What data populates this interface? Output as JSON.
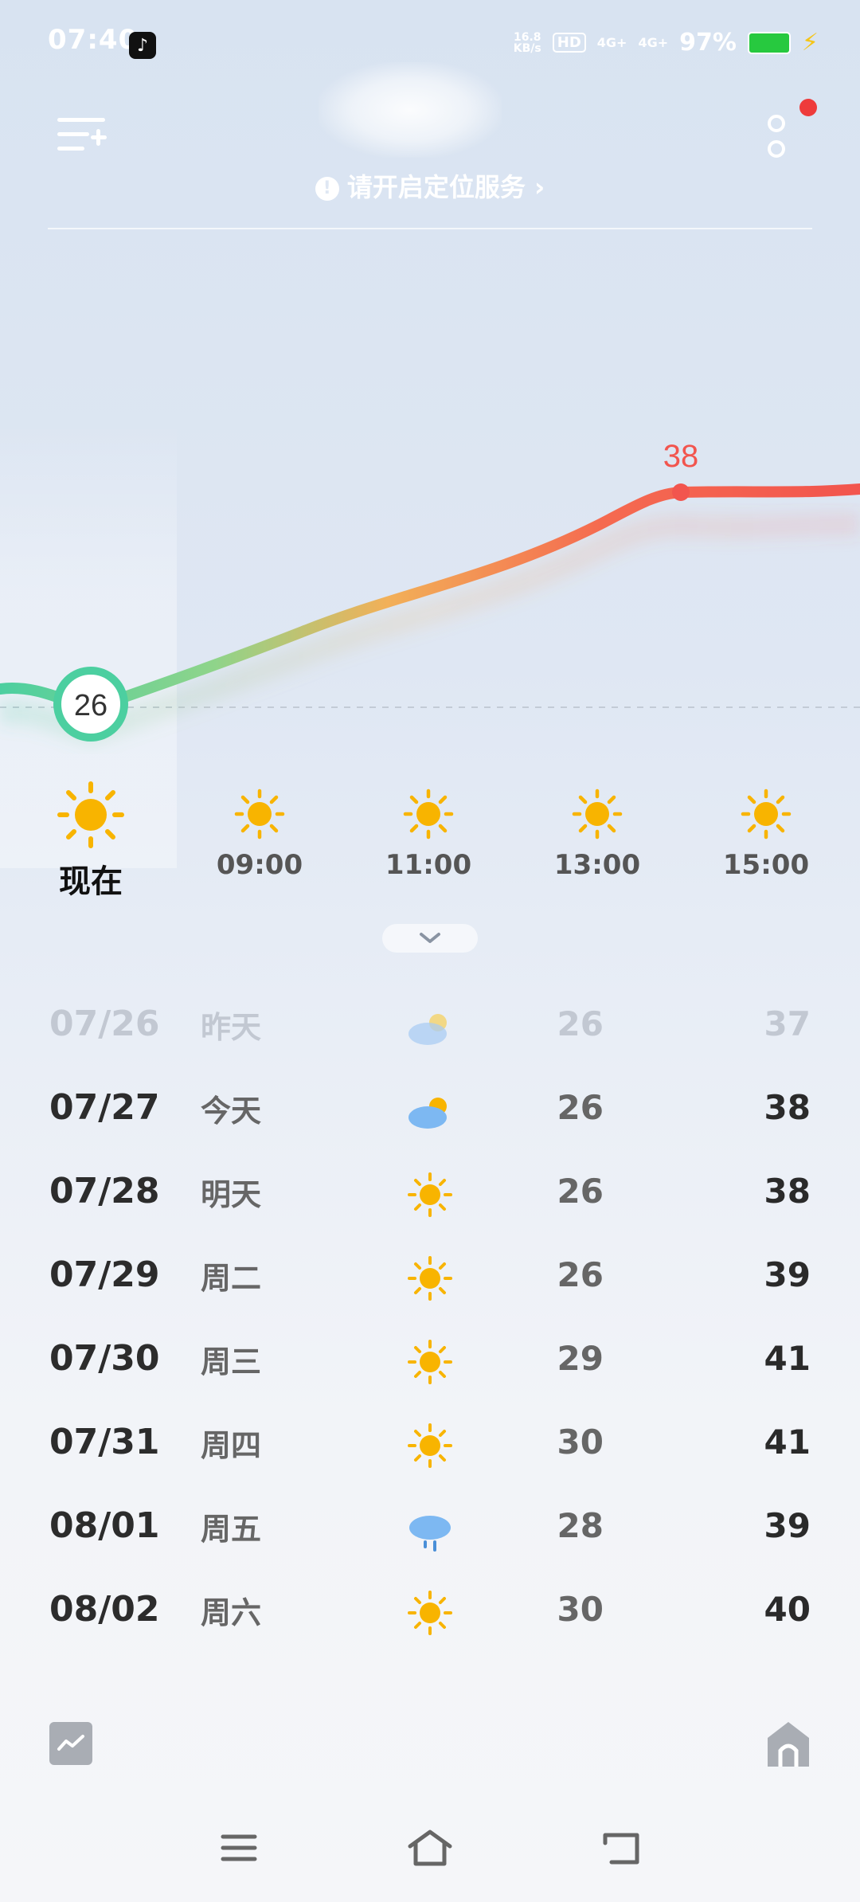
{
  "status_bar": {
    "time": "07:40",
    "app_icon": "tiktok-icon",
    "net_speed_value": "16.8",
    "net_speed_unit": "KB/s",
    "hd": "HD",
    "signal1": "4G+",
    "signal2": "4G+",
    "battery": "97%",
    "battery_color": "#27c93f"
  },
  "header": {
    "location_tip": "请开启定位服务",
    "location_tip_icon": "warning-icon",
    "tip_chevron": "›"
  },
  "hourly": {
    "current_temp": "26",
    "peak_temp": "38",
    "items": [
      {
        "label": "现在",
        "icon": "sun-icon"
      },
      {
        "label": "09:00",
        "icon": "sun-icon"
      },
      {
        "label": "11:00",
        "icon": "sun-icon"
      },
      {
        "label": "13:00",
        "icon": "sun-icon"
      },
      {
        "label": "15:00",
        "icon": "sun-icon"
      }
    ],
    "colors": {
      "cool": "#4ccfa0",
      "warm": "#f6a44c",
      "hot": "#f2554e"
    }
  },
  "daily": [
    {
      "date": "07/26",
      "name": "昨天",
      "icon": "cloudy-sun-icon",
      "low": "26",
      "high": "37"
    },
    {
      "date": "07/27",
      "name": "今天",
      "icon": "cloudy-sun-icon",
      "low": "26",
      "high": "38"
    },
    {
      "date": "07/28",
      "name": "明天",
      "icon": "sun-icon",
      "low": "26",
      "high": "38"
    },
    {
      "date": "07/29",
      "name": "周二",
      "icon": "sun-icon",
      "low": "26",
      "high": "39"
    },
    {
      "date": "07/30",
      "name": "周三",
      "icon": "sun-icon",
      "low": "29",
      "high": "41"
    },
    {
      "date": "07/31",
      "name": "周四",
      "icon": "sun-icon",
      "low": "30",
      "high": "41"
    },
    {
      "date": "08/01",
      "name": "周五",
      "icon": "rain-cloud-icon",
      "low": "28",
      "high": "39"
    },
    {
      "date": "08/02",
      "name": "周六",
      "icon": "sun-icon",
      "low": "30",
      "high": "40"
    }
  ],
  "nav": {
    "menu": "menu-icon",
    "home": "home-icon",
    "back": "back-icon"
  }
}
